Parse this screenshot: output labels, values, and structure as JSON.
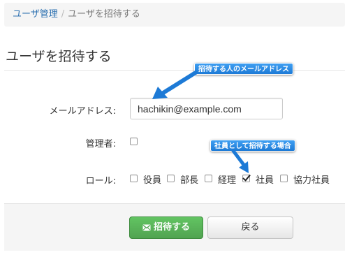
{
  "breadcrumb": {
    "parent": "ユーザ管理",
    "separator": "/",
    "current": "ユーザを招待する"
  },
  "page_title": "ユーザを招待する",
  "form": {
    "email_label": "メールアドレス:",
    "email_value": "hachikin@example.com",
    "admin_label": "管理者:",
    "admin_checked": false,
    "role_label": "ロール:",
    "roles": [
      {
        "label": "役員",
        "checked": false
      },
      {
        "label": "部長",
        "checked": false
      },
      {
        "label": "経理",
        "checked": false
      },
      {
        "label": "社員",
        "checked": true
      },
      {
        "label": "協力社員",
        "checked": false
      }
    ]
  },
  "actions": {
    "invite_label": "招待する",
    "back_label": "戻る"
  },
  "annotations": {
    "email_callout": "招待する人のメールアドレス",
    "role_callout": "社員として招待する場合"
  },
  "colors": {
    "link": "#2a6fb0",
    "invite_button": "#51a351",
    "callout": "#1d7ad6"
  }
}
